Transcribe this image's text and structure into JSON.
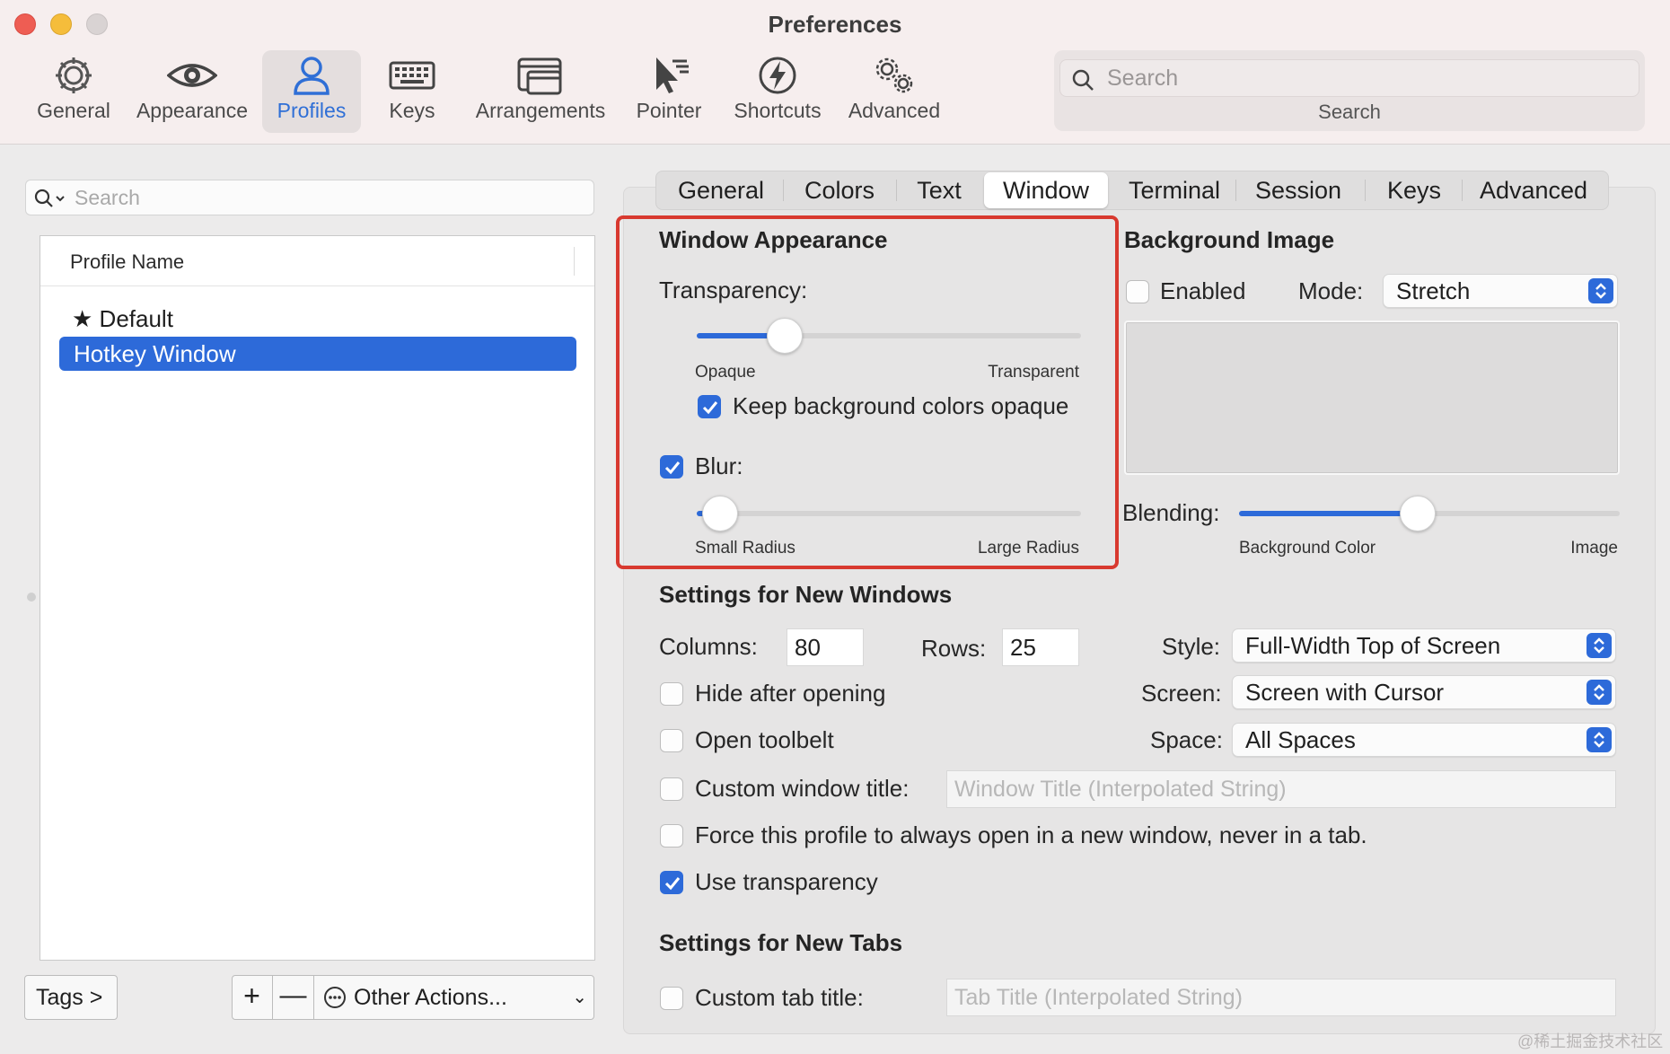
{
  "window": {
    "title": "Preferences"
  },
  "toolbar": {
    "items": [
      {
        "label": "General",
        "icon": "gear-icon"
      },
      {
        "label": "Appearance",
        "icon": "eye-icon"
      },
      {
        "label": "Profiles",
        "icon": "person-icon",
        "active": true
      },
      {
        "label": "Keys",
        "icon": "keyboard-icon"
      },
      {
        "label": "Arrangements",
        "icon": "windows-icon"
      },
      {
        "label": "Pointer",
        "icon": "pointer-icon"
      },
      {
        "label": "Shortcuts",
        "icon": "bolt-icon"
      },
      {
        "label": "Advanced",
        "icon": "gears-icon"
      }
    ],
    "search": {
      "placeholder": "Search",
      "caption": "Search"
    }
  },
  "profiles": {
    "search_placeholder": "Search",
    "column_header": "Profile Name",
    "items": [
      {
        "name": "Default",
        "star": "★",
        "selected": false
      },
      {
        "name": "Hotkey Window",
        "selected": true
      }
    ],
    "tags_button": "Tags >",
    "add_label": "+",
    "remove_label": "—",
    "other_actions": "Other Actions...",
    "chevron": "⌄"
  },
  "tabs": {
    "items": [
      "General",
      "Colors",
      "Text",
      "Window",
      "Terminal",
      "Session",
      "Keys",
      "Advanced"
    ],
    "active": "Window"
  },
  "window_appearance": {
    "heading": "Window Appearance",
    "transparency_label": "Transparency:",
    "transparency_value": 0.23,
    "transparency_min_label": "Opaque",
    "transparency_max_label": "Transparent",
    "keep_bg_opaque": {
      "label": "Keep background colors opaque",
      "checked": true
    },
    "blur": {
      "label": "Blur:",
      "checked": true
    },
    "blur_value": 0.06,
    "blur_min_label": "Small Radius",
    "blur_max_label": "Large Radius"
  },
  "background_image": {
    "heading": "Background Image",
    "enabled": {
      "label": "Enabled",
      "checked": false
    },
    "mode_label": "Mode:",
    "mode_value": "Stretch",
    "blending_label": "Blending:",
    "blending_value": 0.47,
    "blending_min_label": "Background Color",
    "blending_max_label": "Image"
  },
  "new_windows": {
    "heading": "Settings for New Windows",
    "columns_label": "Columns:",
    "columns_value": "80",
    "rows_label": "Rows:",
    "rows_value": "25",
    "style_label": "Style:",
    "style_value": "Full-Width Top of Screen",
    "screen_label": "Screen:",
    "screen_value": "Screen with Cursor",
    "space_label": "Space:",
    "space_value": "All Spaces",
    "hide_after_opening": {
      "label": "Hide after opening",
      "checked": false
    },
    "open_toolbelt": {
      "label": "Open toolbelt",
      "checked": false
    },
    "custom_window_title": {
      "label": "Custom window title:",
      "checked": false,
      "placeholder": "Window Title (Interpolated String)"
    },
    "force_new_window": {
      "label": "Force this profile to always open in a new window, never in a tab.",
      "checked": false
    },
    "use_transparency": {
      "label": "Use transparency",
      "checked": true
    }
  },
  "new_tabs": {
    "heading": "Settings for New Tabs",
    "custom_tab_title": {
      "label": "Custom tab title:",
      "checked": false,
      "placeholder": "Tab Title (Interpolated String)"
    }
  },
  "watermark": "@稀土掘金技术社区",
  "colors": {
    "accent": "#2d6ad9",
    "highlight_box": "#d8392f"
  }
}
